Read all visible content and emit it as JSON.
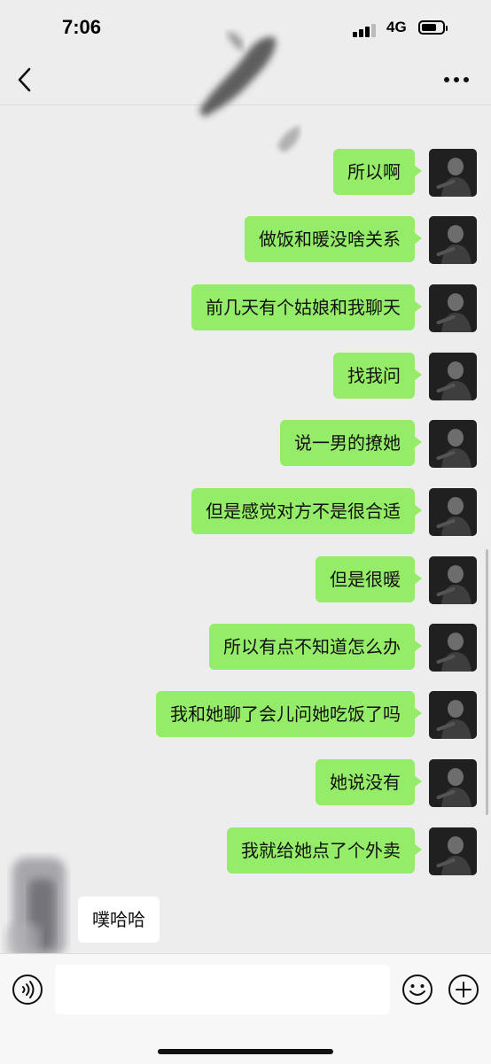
{
  "status_bar": {
    "time": "7:06",
    "network": "4G",
    "battery_level": 0.72
  },
  "nav": {
    "back_icon": "chevron-left-icon",
    "more_icon": "ellipsis-icon"
  },
  "messages_out": [
    {
      "text": "所以啊"
    },
    {
      "text": "做饭和暖没啥关系"
    },
    {
      "text": "前几天有个姑娘和我聊天"
    },
    {
      "text": "找我问"
    },
    {
      "text": "说一男的撩她"
    },
    {
      "text": "但是感觉对方不是很合适"
    },
    {
      "text": "但是很暖"
    },
    {
      "text": "所以有点不知道怎么办"
    },
    {
      "text": "我和她聊了会儿问她吃饭了吗"
    },
    {
      "text": "她说没有"
    },
    {
      "text": "我就给她点了个外卖"
    }
  ],
  "message_in": {
    "text": "噗哈哈"
  },
  "input_bar": {
    "placeholder": "",
    "voice_icon": "voice-icon",
    "emoji_icon": "emoji-icon",
    "plus_icon": "plus-icon"
  },
  "colors": {
    "outgoing_bubble": "#95ec69",
    "incoming_bubble": "#ffffff",
    "background": "#ededed"
  }
}
